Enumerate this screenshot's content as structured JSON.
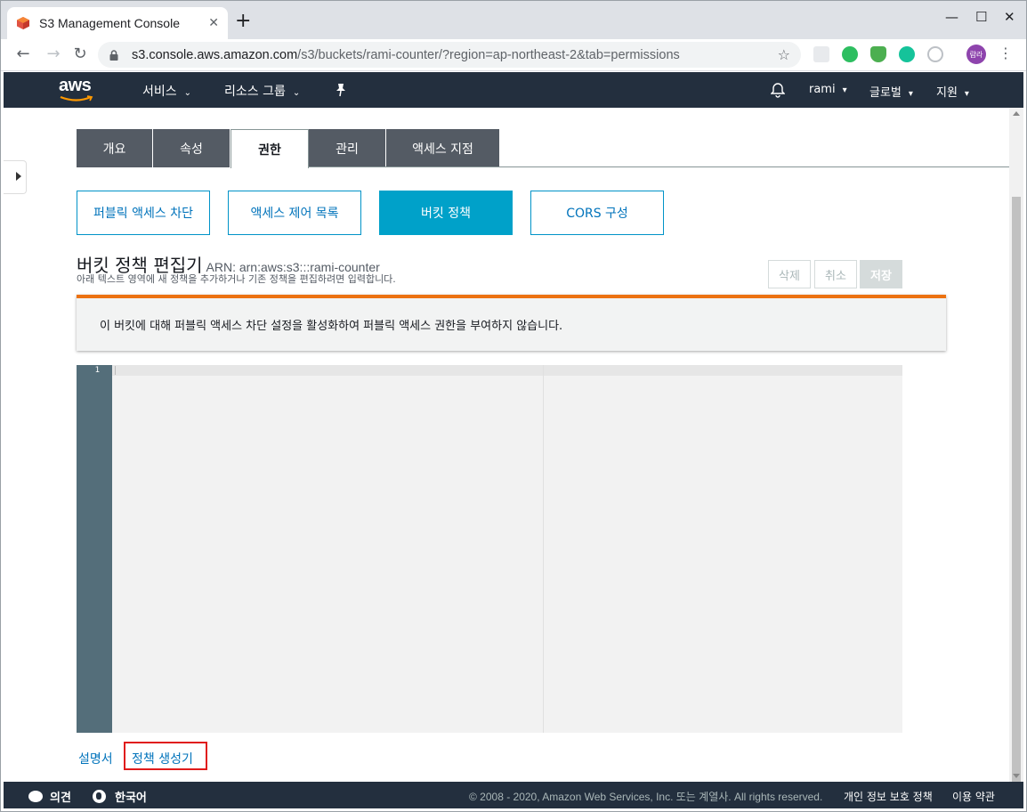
{
  "browser": {
    "tab_title": "S3 Management Console",
    "tab_close": "✕",
    "new_tab": "+",
    "minimize": "—",
    "maximize": "☐",
    "close": "✕",
    "url_host": "s3.console.aws.amazon.com",
    "url_path": "/s3/buckets/rami-counter/?region=ap-northeast-2&tab=permissions",
    "avatar_text": "람라"
  },
  "awsnav": {
    "logo": "aws",
    "services": "서비스",
    "resource_groups": "리소스 그룹",
    "user": "rami",
    "region": "글로벌",
    "support": "지원"
  },
  "tabs": [
    "개요",
    "속성",
    "권한",
    "관리",
    "액세스 지점"
  ],
  "active_tab": "권한",
  "subtabs": [
    "퍼블릭 액세스 차단",
    "액세스 제어 목록",
    "버킷 정책",
    "CORS 구성"
  ],
  "active_subtab": "버킷 정책",
  "editor_header": {
    "title": "버킷 정책 편집기",
    "arn": "ARN: arn:aws:s3:::rami-counter",
    "subtitle": "아래 텍스트 영역에 새 정책을 추가하거나 기존 정책을 편집하려면 입력합니다.",
    "delete": "삭제",
    "cancel": "취소",
    "save": "저장"
  },
  "alert": "이 버킷에 대해 퍼블릭 액세스 차단 설정을 활성화하여 퍼블릭 액세스 권한을 부여하지 않습니다.",
  "editor": {
    "line_number": "1",
    "content": ""
  },
  "links": {
    "docs": "설명서",
    "policy_generator": "정책 생성기"
  },
  "footer": {
    "feedback": "의견",
    "language": "한국어",
    "copyright": "© 2008 - 2020, Amazon Web Services, Inc. 또는 계열사. All rights reserved.",
    "privacy": "개인 정보 보호 정책",
    "terms": "이용 약관"
  },
  "colors": {
    "aws_nav": "#232f3e",
    "accent_blue": "#00a1c9",
    "alert_orange": "#ec7211",
    "highlight_red": "#e01b1b"
  }
}
